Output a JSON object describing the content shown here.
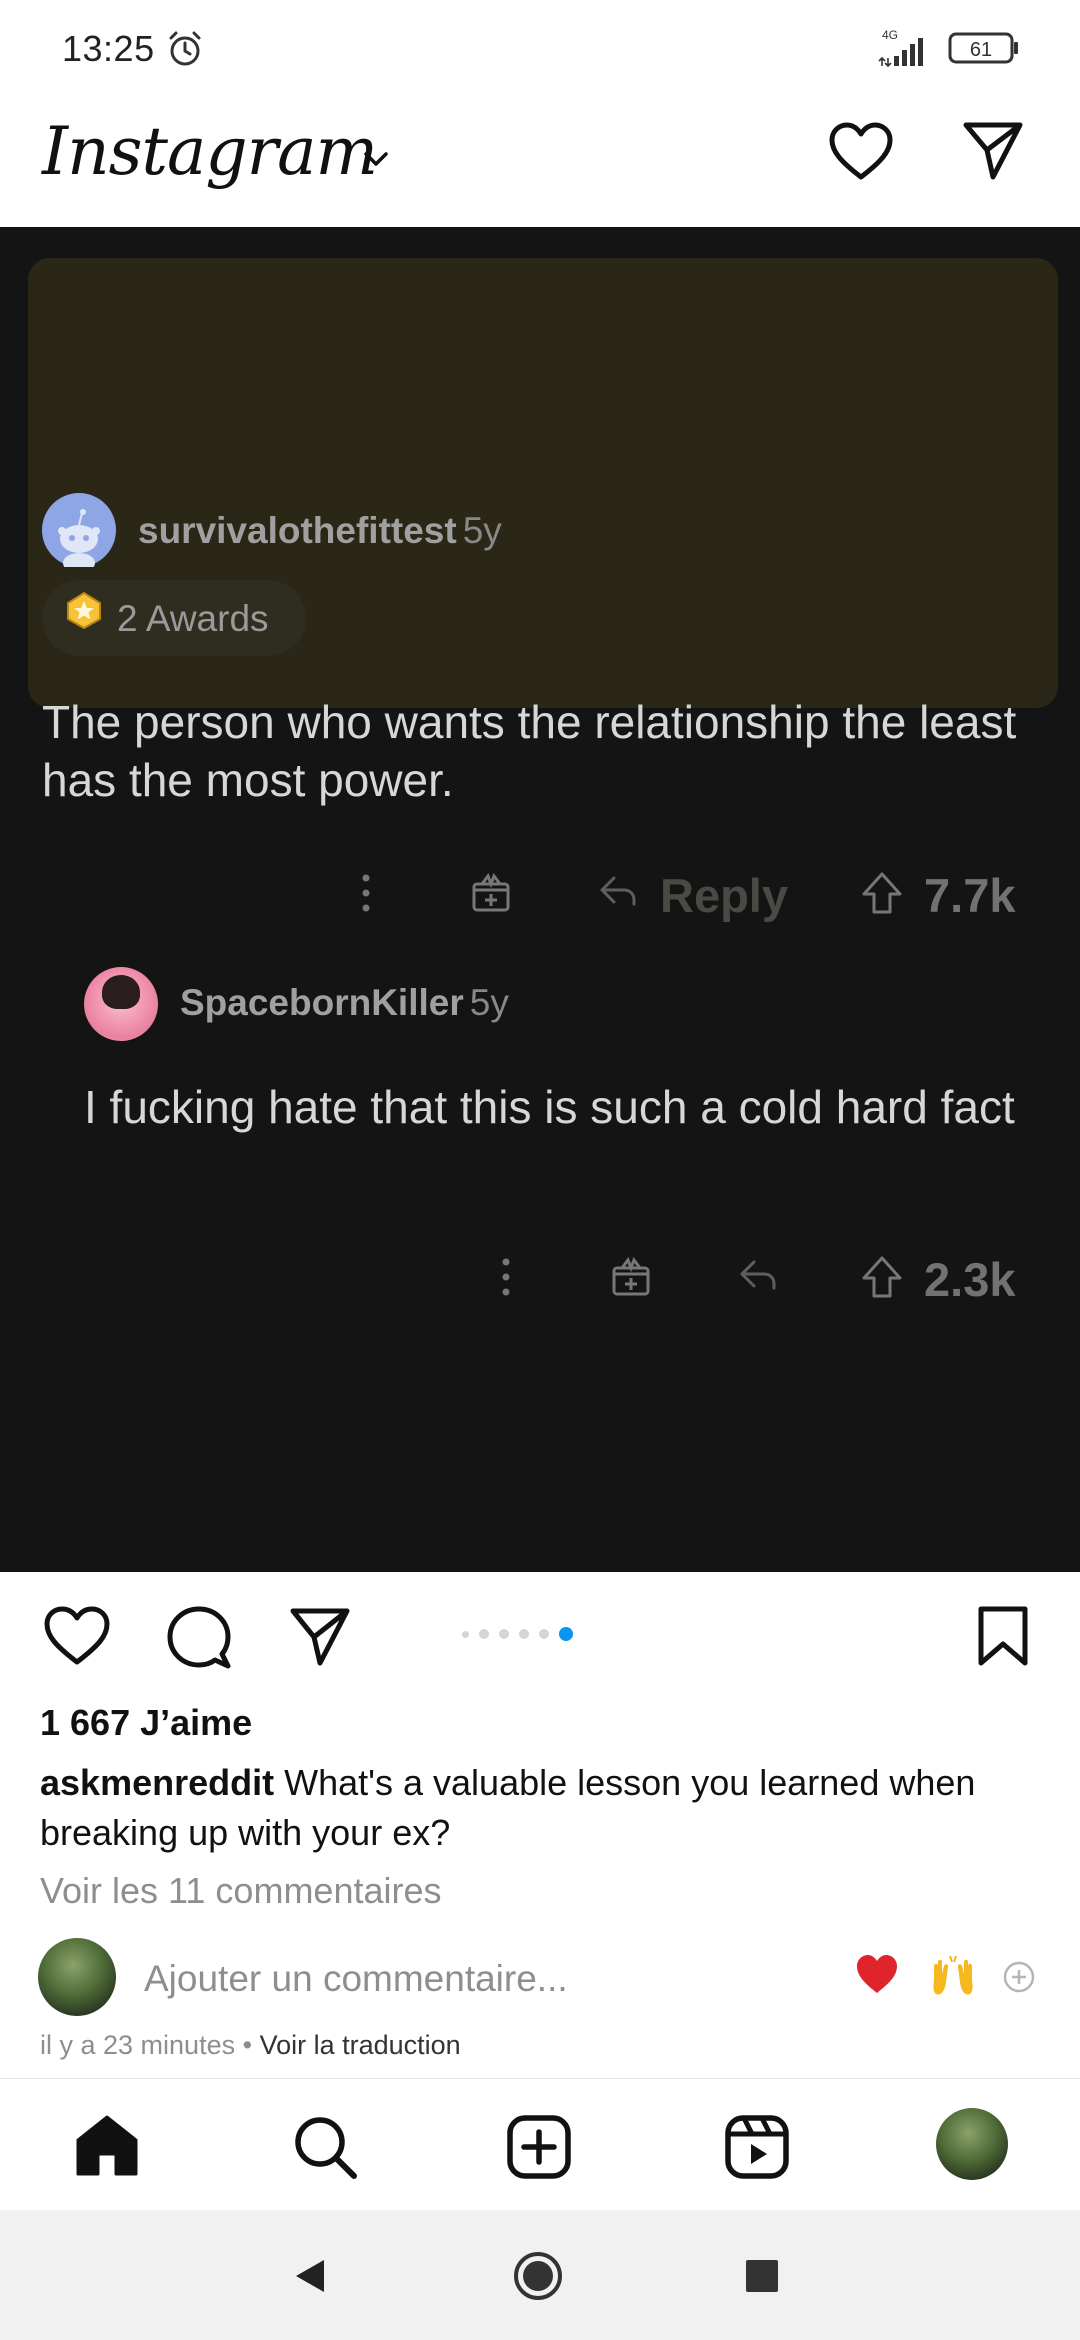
{
  "status_bar": {
    "time": "13:25",
    "network": "4G",
    "battery": "61"
  },
  "header": {
    "logo": "Instagram"
  },
  "post": {
    "comments": [
      {
        "username": "survivalothefittest",
        "age": "5y",
        "awards": "2 Awards",
        "text": "The person who wants the relationship the least has the most power.",
        "reply_label": "Reply",
        "votes": "7.7k",
        "highlight_color": "#2b2716"
      },
      {
        "username": "SpacebornKiller",
        "age": "5y",
        "text": "I fucking hate that this is such a cold hard fact",
        "votes": "2.3k"
      }
    ],
    "carousel": {
      "count": 6,
      "active_index": 6,
      "active_color": "#0a95f0"
    },
    "likes": "1 667 J’aime",
    "caption_user": "askmenreddit",
    "caption_text": "What's a valuable lesson you learned when breaking up with your ex?",
    "view_comments": "Voir les 11 commentaires",
    "add_comment_placeholder": "Ajouter un commentaire...",
    "time_ago": "il y a 23 minutes",
    "separator": "•",
    "translate": "Voir la traduction"
  },
  "icons": {
    "header": [
      "heart-icon",
      "direct-message-icon"
    ],
    "post_actions": [
      "like-icon",
      "comment-icon",
      "share-icon",
      "bookmark-icon"
    ],
    "bottom_nav": [
      "home-icon",
      "search-icon",
      "create-icon",
      "reels-icon",
      "profile-avatar"
    ],
    "system_nav": [
      "back-icon",
      "home-circle-icon",
      "recents-icon"
    ]
  }
}
